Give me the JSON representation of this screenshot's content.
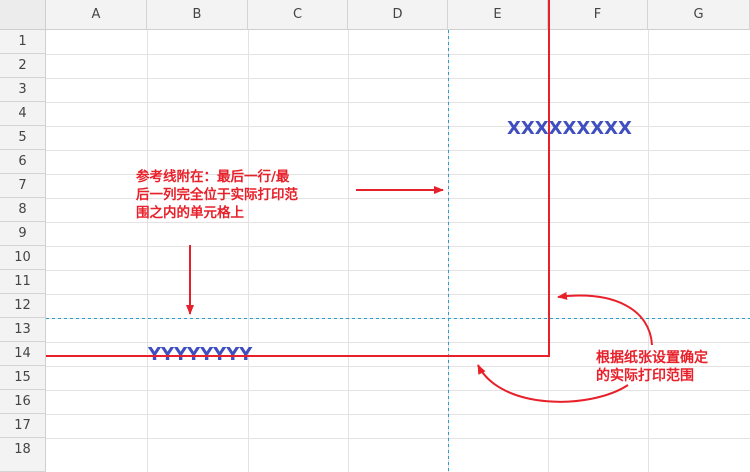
{
  "columns": [
    "A",
    "B",
    "C",
    "D",
    "E",
    "F",
    "G"
  ],
  "rows": [
    "1",
    "2",
    "3",
    "4",
    "5",
    "6",
    "7",
    "8",
    "9",
    "10",
    "11",
    "12",
    "13",
    "14",
    "15",
    "16",
    "17",
    "18"
  ],
  "cells": {
    "f5": "XXXXXXXXX",
    "b14": "YYYYYYYY"
  },
  "annotations": {
    "guide_note": "参考线附在：最后一行/最后一列完全位于实际打印范围之内的单元格上",
    "guide_note_lines": [
      "参考线附在：最后一行/最",
      "后一列完全位于实际打印范",
      "围之内的单元格上"
    ],
    "paper_note_lines": [
      "根据纸张设置确定",
      "的实际打印范围"
    ]
  },
  "colors": {
    "annotation_red": "#e8202a",
    "guide_line_teal": "#2aa0c8",
    "cell_text_blue": "#3f4fbf"
  }
}
